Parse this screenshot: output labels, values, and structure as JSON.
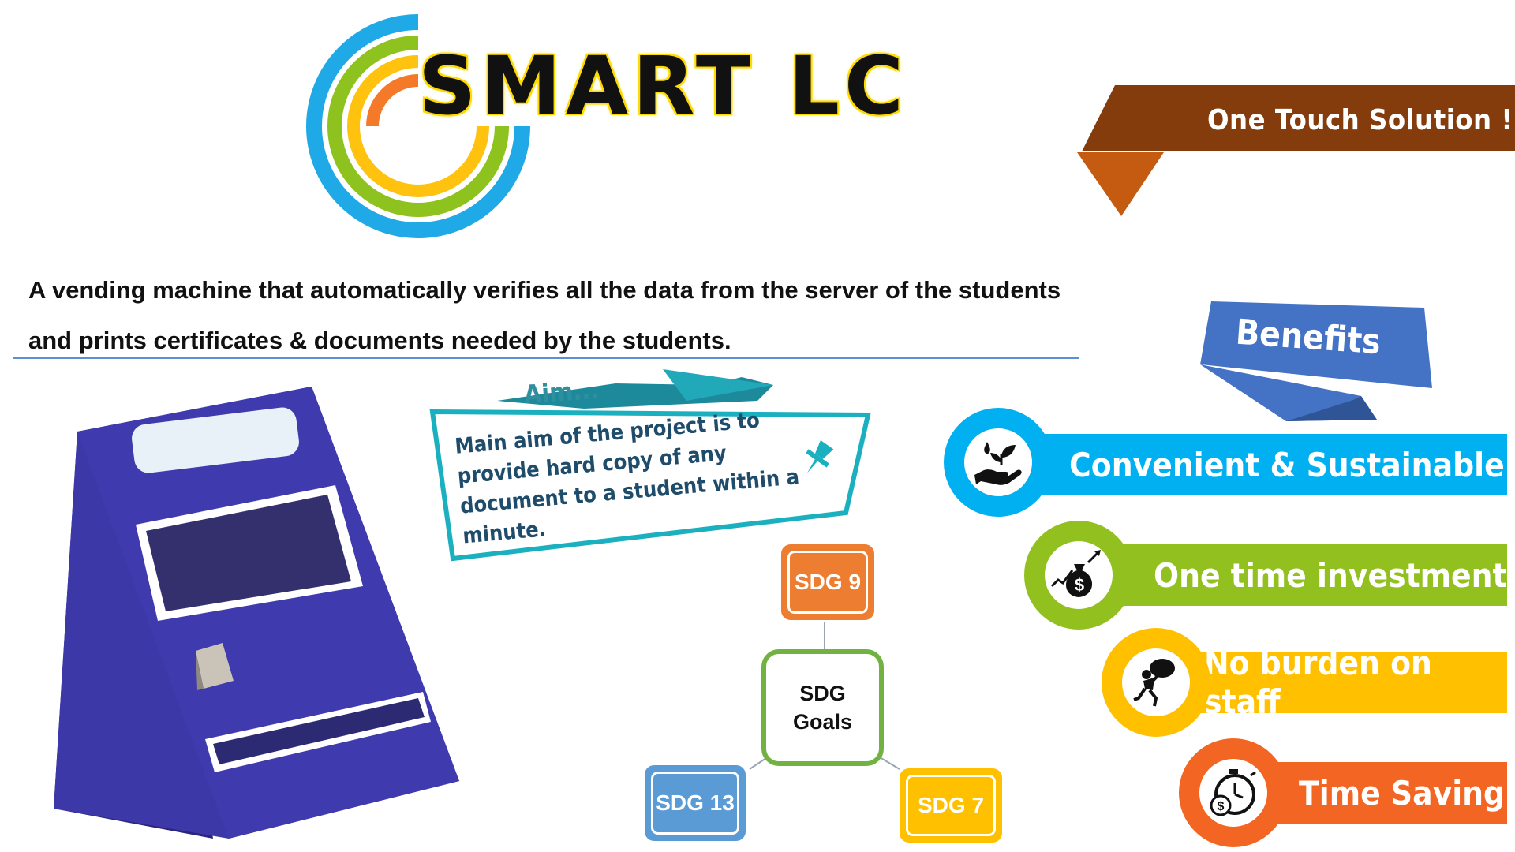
{
  "logo": {
    "text": "SMART LC"
  },
  "tagline": "One Touch Solution !",
  "description": "A vending machine that automatically verifies all the data from the server of the students and prints certificates & documents needed by the students.",
  "aim": {
    "label": "Aim...",
    "text": "Main aim of the project is to provide hard copy of any document to a student within a minute."
  },
  "sdg": {
    "center_line1": "SDG",
    "center_line2": "Goals",
    "items": [
      {
        "label": "SDG 9",
        "color": "#ed7d31"
      },
      {
        "label": "SDG 13",
        "color": "#5b9bd5"
      },
      {
        "label": "SDG 7",
        "color": "#ffc000"
      }
    ],
    "center_color": "#72b242"
  },
  "benefits": {
    "title": "Benefits",
    "title_color": "#4472c4",
    "items": [
      {
        "label": "Convenient & Sustainable",
        "icon": "plant-hand-icon",
        "color": "#00b0f0"
      },
      {
        "label": "One time investment",
        "icon": "money-bag-icon",
        "color": "#92c01f"
      },
      {
        "label": "No burden on staff",
        "icon": "person-carrying-burden-icon",
        "color": "#ffc000"
      },
      {
        "label": "Time Saving",
        "icon": "stopwatch-money-icon",
        "color": "#f26522"
      }
    ]
  },
  "colors": {
    "banner_brown": "#843c0c",
    "banner_fold": "#c55a11",
    "machine_blue": "#3b35a3",
    "machine_side": "#2a2680",
    "aim_teal": "#1aa6b7"
  }
}
